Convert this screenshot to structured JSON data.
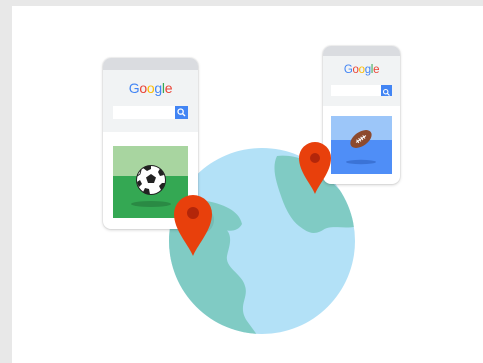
{
  "illustration": {
    "left_card": {
      "brand": "Google",
      "sport_icon": "soccer-ball-icon",
      "search_icon": "search-icon"
    },
    "right_card": {
      "brand": "Google",
      "sport_icon": "american-football-icon",
      "search_icon": "search-icon"
    },
    "colors": {
      "globe_ocean": "#b3e1f7",
      "globe_land": "#80cbc4",
      "pin": "#e8400c",
      "pin_dot": "#b3260a",
      "field_green": "#34a853",
      "field_sky_green": "#a8d5a0",
      "field_blue": "#4f8ef7",
      "field_sky_blue": "#9cc6f9",
      "google_blue": "#4285f4"
    }
  }
}
